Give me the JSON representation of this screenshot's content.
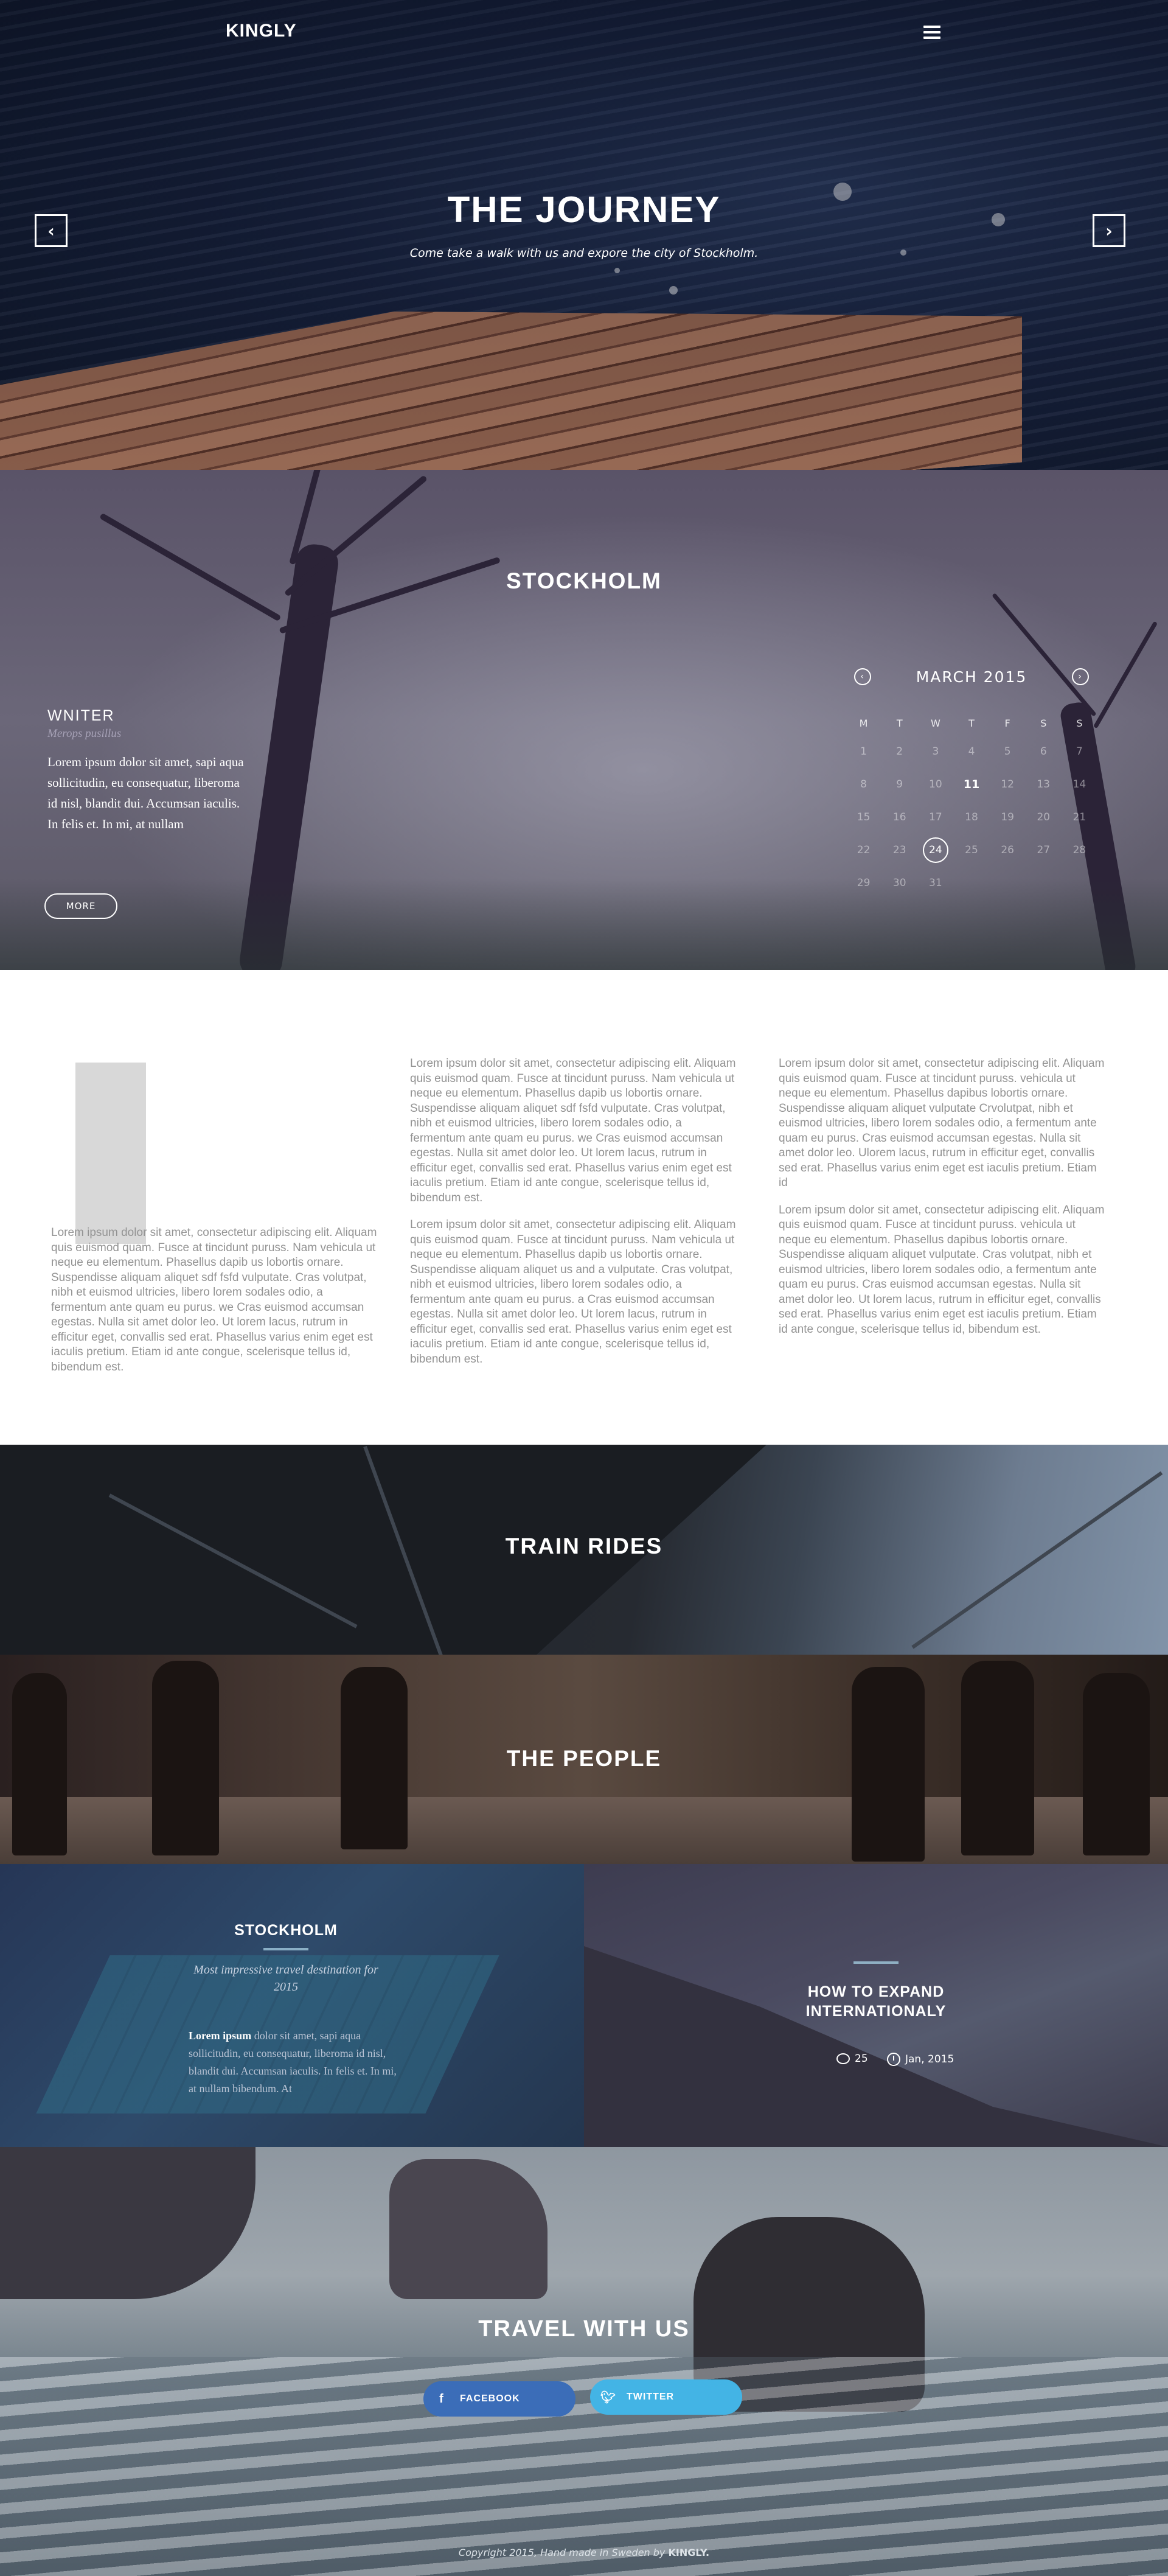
{
  "header": {
    "logo": "KINGLY"
  },
  "hero": {
    "title": "THE JOURNEY",
    "subtitle": "Come take a walk with us and expore the city of Stockholm."
  },
  "city": {
    "title": "STOCKHOLM",
    "writer": {
      "heading": "WNITER",
      "latin": "Merops pusillus",
      "text": "Lorem ipsum dolor sit amet, sapi aqua sollicitudin, eu consequatur, liberoma id nisl, blandit dui. Accumsan iaculis. In felis et. In mi, at nullam",
      "more_label": "MORE"
    },
    "calendar": {
      "month": "MARCH 2015",
      "weekdays": [
        "M",
        "T",
        "W",
        "T",
        "F",
        "S",
        "S"
      ],
      "days": [
        [
          "1",
          "2",
          "3",
          "4",
          "5",
          "6",
          "7"
        ],
        [
          "8",
          "9",
          "10",
          "11",
          "12",
          "13",
          "14"
        ],
        [
          "15",
          "16",
          "17",
          "18",
          "19",
          "20",
          "21"
        ],
        [
          "22",
          "23",
          "24",
          "25",
          "26",
          "27",
          "28"
        ],
        [
          "29",
          "30",
          "31",
          "",
          "",
          "",
          ""
        ]
      ],
      "today": "11",
      "selected": "24"
    }
  },
  "text": {
    "col1": "Lorem ipsum dolor sit amet, consectetur adipiscing elit. Aliquam quis euismod quam. Fusce at tincidunt puruss. Nam vehicula ut neque eu elementum. Phasellus dapib us lobortis ornare. Suspendisse aliquam aliquet sdf fsfd vulputate. Cras volutpat, nibh et euismod ultricies, libero lorem sodales odio, a fermentum ante quam eu purus. we Cras euismod accumsan egestas. Nulla sit amet dolor leo. Ut lorem lacus, rutrum in efficitur eget, convallis sed erat. Phasellus varius enim eget est iaculis pretium. Etiam id ante congue, scelerisque tellus id, bibendum est.",
    "col2a": "Lorem ipsum dolor sit amet, consectetur adipiscing elit. Aliquam quis euismod quam. Fusce at tincidunt puruss. Nam vehicula ut neque eu elementum. Phasellus dapib us lobortis ornare. Suspendisse aliquam aliquet sdf fsfd vulputate. Cras volutpat, nibh et euismod ultricies, libero lorem sodales odio, a fermentum ante quam eu purus. we Cras euismod accumsan egestas. Nulla sit amet dolor leo. Ut lorem lacus, rutrum in efficitur eget, convallis sed erat. Phasellus varius enim eget est iaculis pretium. Etiam id ante congue, scelerisque tellus id, bibendum est.",
    "col2b": "Lorem ipsum dolor sit amet, consectetur adipiscing elit. Aliquam quis euismod quam. Fusce at tincidunt puruss. Nam vehicula ut neque eu elementum. Phasellus dapib us lobortis ornare. Suspendisse aliquam aliquet us and a vulputate. Cras volutpat, nibh et euismod ultricies, libero lorem sodales odio, a fermentum ante quam eu purus. a Cras euismod accumsan egestas. Nulla sit amet dolor leo. Ut lorem lacus, rutrum in efficitur eget, convallis sed erat. Phasellus varius enim eget est iaculis pretium. Etiam id ante congue, scelerisque tellus id, bibendum est.",
    "col3a": "Lorem ipsum dolor sit amet, consectetur adipiscing elit. Aliquam quis euismod quam. Fusce at tincidunt puruss. vehicula ut neque eu elementum. Phasellus dapibus lobortis ornare. Suspendisse aliquam aliquet vulputate Crvolutpat, nibh et euismod ultricies, libero lorem sodales odio, a fermentum ante quam eu purus. Cras euismod accumsan egestas. Nulla sit amet dolor leo. Ulorem lacus, rutrum in efficitur eget, convallis sed erat. Phasellus varius enim eget est iaculis pretium. Etiam id",
    "col3b": "Lorem ipsum dolor sit amet, consectetur adipiscing elit. Aliquam quis euismod quam. Fusce at tincidunt puruss. vehicula ut neque eu elementum. Phasellus dapibus lobortis ornare. Suspendisse aliquam aliquet vulputate. Cras volutpat, nibh et euismod ultricies, libero lorem sodales odio, a fermentum ante quam eu purus. Cras euismod accumsan egestas. Nulla sit amet dolor leo. Ut lorem lacus, rutrum in efficitur eget, convallis sed erat. Phasellus varius enim eget est iaculis pretium. Etiam id ante congue, scelerisque tellus id, bibendum est."
  },
  "train": {
    "title": "TRAIN RIDES"
  },
  "people": {
    "title": "THE PEOPLE"
  },
  "panels": {
    "left": {
      "title": "STOCKHOLM",
      "tagline": "Most impressive travel destination for 2015",
      "lead": "Lorem ipsum",
      "text": " dolor sit amet, sapi aqua sollicitudin, eu consequatur, liberoma id nisl, blandit dui. Accumsan iaculis. In felis et. In mi, at nullam bibendum. At"
    },
    "right": {
      "title": "HOW TO EXPAND INTERNATIONALY",
      "comments": "25",
      "date": "Jan, 2015"
    }
  },
  "travel": {
    "title": "TRAVEL WITH US",
    "facebook_label": "FACEBOOK",
    "twitter_label": "TWITTER",
    "facebook_color": "#3b6db8",
    "twitter_color": "#43b4e5"
  },
  "footer": {
    "text": "Copyright 2015, Hand made in Sweden by ",
    "brand": "KINGLY."
  }
}
